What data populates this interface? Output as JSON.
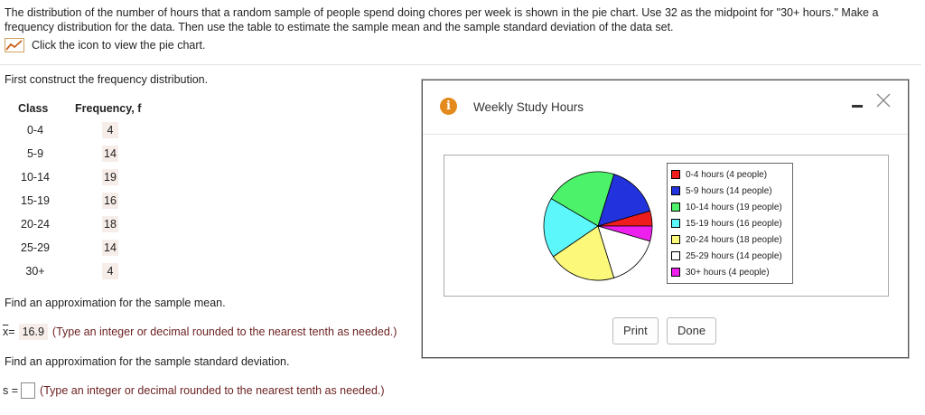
{
  "problem": {
    "text": "The distribution of the number of hours that a random sample of people spend doing chores per week is shown in the pie chart. Use 32 as the midpoint for \"30+ hours.\" Make a frequency distribution for the data. Then use the table to estimate the sample mean and the sample standard deviation of the data set.",
    "chart_link": "Click the icon to view the pie chart."
  },
  "section": {
    "construct": "First construct the frequency distribution.",
    "mean_prompt": "Find an approximation for the sample mean.",
    "sd_prompt": "Find an approximation for the sample standard deviation."
  },
  "table": {
    "class_header": "Class",
    "freq_header": "Frequency, f",
    "rows": [
      {
        "cls": "0-4",
        "freq": "4"
      },
      {
        "cls": "5-9",
        "freq": "14"
      },
      {
        "cls": "10-14",
        "freq": "19"
      },
      {
        "cls": "15-19",
        "freq": "16"
      },
      {
        "cls": "20-24",
        "freq": "18"
      },
      {
        "cls": "25-29",
        "freq": "14"
      },
      {
        "cls": "30+",
        "freq": "4"
      }
    ]
  },
  "answers": {
    "mean_label": "x",
    "mean_eq": "=",
    "mean_value": "16.9",
    "mean_hint": "(Type an integer or decimal rounded to the nearest tenth as needed.)",
    "sd_label": "s =",
    "sd_value": "",
    "sd_hint": "(Type an integer or decimal rounded to the nearest tenth as needed.)"
  },
  "popup": {
    "title": "Weekly Study Hours",
    "info_glyph": "i",
    "print_label": "Print",
    "done_label": "Done"
  },
  "chart_data": {
    "type": "pie",
    "title": "",
    "slices": [
      {
        "label": "0-4 hours (4 people)",
        "value": 4,
        "color": "#ee1c1c"
      },
      {
        "label": "5-9 hours (14 people)",
        "value": 14,
        "color": "#2233dd"
      },
      {
        "label": "10-14 hours (19 people)",
        "value": 19,
        "color": "#4cf26a"
      },
      {
        "label": "15-19 hours (16 people)",
        "value": 16,
        "color": "#5cf7fb"
      },
      {
        "label": "20-24 hours (18 people)",
        "value": 18,
        "color": "#fbf87a"
      },
      {
        "label": "25-29 hours (14 people)",
        "value": 14,
        "color": "#ffffff"
      },
      {
        "label": "30+ hours (4 people)",
        "value": 4,
        "color": "#ee20ee"
      }
    ],
    "legend_position": "right"
  }
}
